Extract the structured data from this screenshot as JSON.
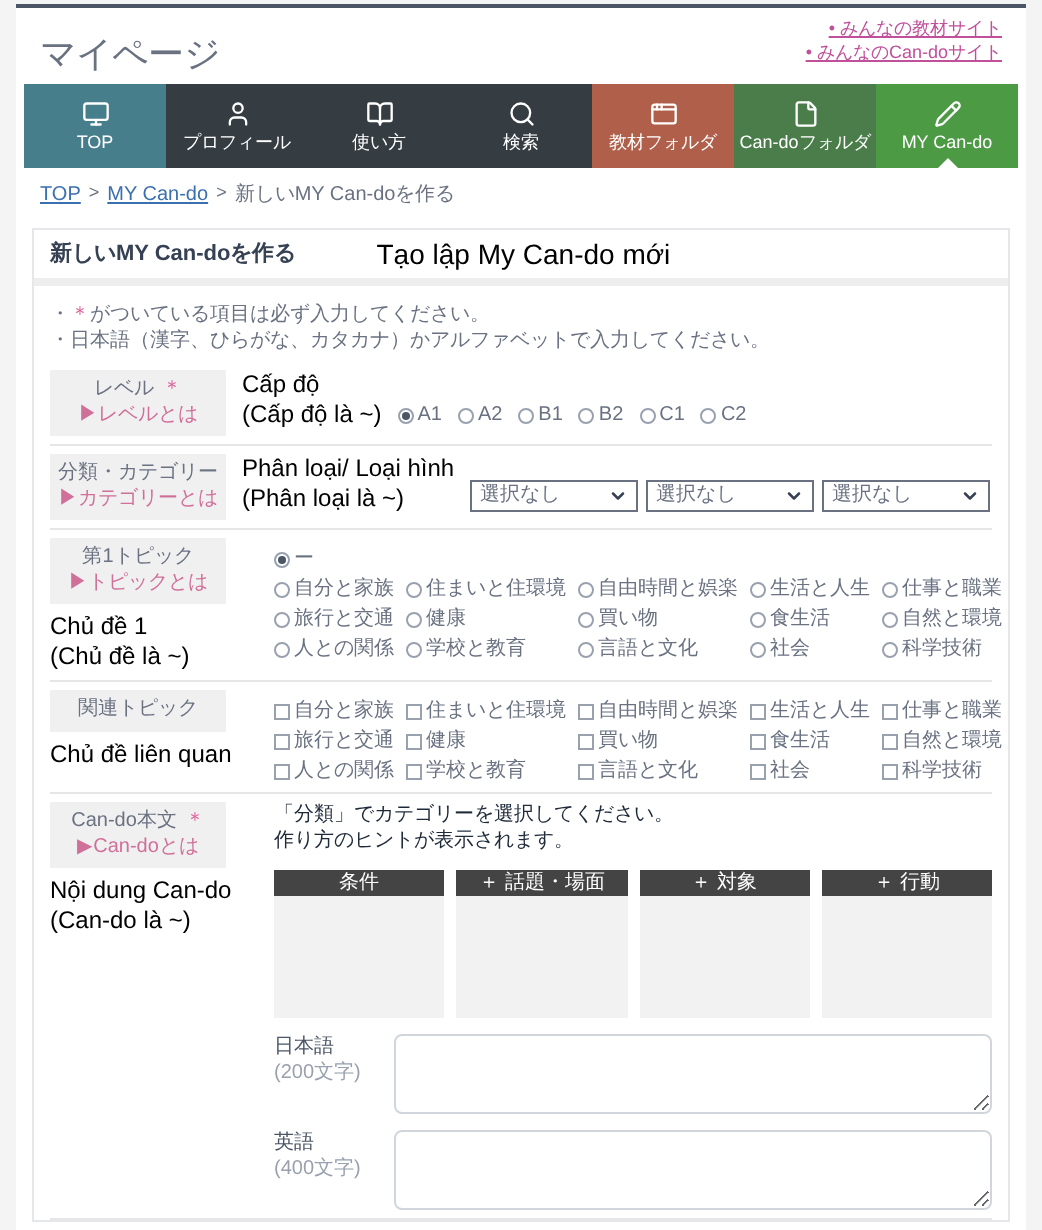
{
  "header": {
    "title": "マイページ",
    "links": [
      "• みんなの教材サイト",
      "• みんなのCan-doサイト"
    ]
  },
  "nav": [
    {
      "label": "TOP",
      "color": "#477e8c",
      "selected": false
    },
    {
      "label": "プロフィール",
      "color": "#363d42",
      "selected": false
    },
    {
      "label": "使い方",
      "color": "#363d42",
      "selected": false
    },
    {
      "label": "検索",
      "color": "#363d42",
      "selected": false
    },
    {
      "label": "教材フォルダ",
      "color": "#b0604a",
      "selected": false
    },
    {
      "label": "Can-doフォルダ",
      "color": "#4b7d4b",
      "selected": false
    },
    {
      "label": "MY Can-do",
      "color": "#4d9a45",
      "selected": true
    }
  ],
  "breadcrumb": {
    "separator": ">",
    "items": [
      {
        "label": "TOP",
        "link": true
      },
      {
        "label": "MY Can-do",
        "link": true
      },
      {
        "label": "新しいMY Can-doを作る",
        "link": false
      }
    ]
  },
  "form": {
    "title": "新しいMY Can-doを作る",
    "annotation": "Tạo lập My Can-do mới",
    "notes": [
      {
        "bullet": "・",
        "mark": "＊",
        "text": "がついている項目は必ず入力してください。"
      },
      {
        "bullet": "・",
        "text": "日本語（漢字、ひらがな、カタカナ）かアルファベットで入力してください。"
      }
    ],
    "rows": [
      {
        "kind": "radios",
        "label": "レベル",
        "required_mark": "＊",
        "help": "▶レベルとは",
        "annotation": [
          "Cấp độ",
          "(Cấp độ là ~)"
        ],
        "options": [
          {
            "label": "A1",
            "selected": true
          },
          {
            "label": "A2",
            "selected": false
          },
          {
            "label": "B1",
            "selected": false
          },
          {
            "label": "B2",
            "selected": false
          },
          {
            "label": "C1",
            "selected": false
          },
          {
            "label": "C2",
            "selected": false
          }
        ]
      },
      {
        "kind": "selects",
        "label": "分類・カテゴリー",
        "help": "▶カテゴリーとは",
        "annotation": [
          "Phân loại/ Loại hình",
          "(Phân loại là ~)"
        ],
        "selects": [
          {
            "value": "選択なし"
          },
          {
            "value": "選択なし"
          },
          {
            "value": "選択なし"
          }
        ]
      },
      {
        "kind": "topic_radios",
        "label": "第1トピック",
        "help": "▶トピックとは",
        "annotation": [
          "Chủ đề 1",
          "(Chủ đề là ~)"
        ],
        "none_option": {
          "label": "ー",
          "selected": true
        },
        "options": [
          {
            "label": "自分と家族",
            "selected": false
          },
          {
            "label": "住まいと住環境",
            "selected": false
          },
          {
            "label": "自由時間と娯楽",
            "selected": false
          },
          {
            "label": "生活と人生",
            "selected": false
          },
          {
            "label": "仕事と職業",
            "selected": false
          },
          {
            "label": "旅行と交通",
            "selected": false
          },
          {
            "label": "健康",
            "selected": false
          },
          {
            "label": "買い物",
            "selected": false
          },
          {
            "label": "食生活",
            "selected": false
          },
          {
            "label": "自然と環境",
            "selected": false
          },
          {
            "label": "人との関係",
            "selected": false
          },
          {
            "label": "学校と教育",
            "selected": false
          },
          {
            "label": "言語と文化",
            "selected": false
          },
          {
            "label": "社会",
            "selected": false
          },
          {
            "label": "科学技術",
            "selected": false
          }
        ]
      },
      {
        "kind": "topic_checks",
        "label": "関連トピック",
        "annotation": [
          "Chủ đề liên quan"
        ],
        "options": [
          {
            "label": "自分と家族",
            "checked": false
          },
          {
            "label": "住まいと住環境",
            "checked": false
          },
          {
            "label": "自由時間と娯楽",
            "checked": false
          },
          {
            "label": "生活と人生",
            "checked": false
          },
          {
            "label": "仕事と職業",
            "checked": false
          },
          {
            "label": "旅行と交通",
            "checked": false
          },
          {
            "label": "健康",
            "checked": false
          },
          {
            "label": "買い物",
            "checked": false
          },
          {
            "label": "食生活",
            "checked": false
          },
          {
            "label": "自然と環境",
            "checked": false
          },
          {
            "label": "人との関係",
            "checked": false
          },
          {
            "label": "学校と教育",
            "checked": false
          },
          {
            "label": "言語と文化",
            "checked": false
          },
          {
            "label": "社会",
            "checked": false
          },
          {
            "label": "科学技術",
            "checked": false
          }
        ]
      },
      {
        "kind": "cando",
        "label": "Can-do本文",
        "required_mark": "＊",
        "help": "▶Can-doとは",
        "annotation": [
          "Nội dung Can-do",
          "(Can-do là ~)"
        ],
        "hint": [
          "「分類」でカテゴリーを選択してください。",
          "作り方のヒントが表示されます。"
        ],
        "columns": [
          "条件",
          "＋ 話題・場面",
          "＋ 対象",
          "＋ 行動"
        ],
        "fields": [
          {
            "label": "日本語",
            "limit": "(200文字)"
          },
          {
            "label": "英語",
            "limit": "(400文字)"
          }
        ]
      }
    ]
  }
}
